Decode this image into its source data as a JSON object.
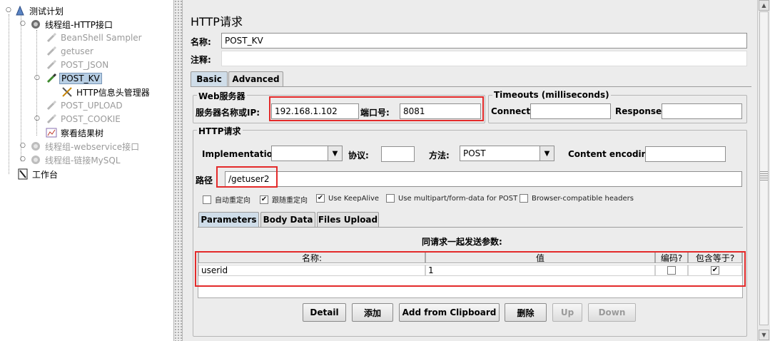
{
  "tree": {
    "items": [
      {
        "label": "测试计划",
        "icon": "test-plan-icon",
        "disabled": false,
        "selected": false
      },
      {
        "label": "线程组-HTTP接口",
        "icon": "gear-icon",
        "disabled": false,
        "selected": false
      },
      {
        "label": "BeanShell Sampler",
        "icon": "pipette-icon",
        "disabled": true,
        "selected": false
      },
      {
        "label": "getuser",
        "icon": "pipette-icon",
        "disabled": true,
        "selected": false
      },
      {
        "label": "POST_JSON",
        "icon": "pipette-icon",
        "disabled": true,
        "selected": false
      },
      {
        "label": "POST_KV",
        "icon": "pipette-icon",
        "disabled": false,
        "selected": true
      },
      {
        "label": "HTTP信息头管理器",
        "icon": "tools-icon",
        "disabled": false,
        "selected": false
      },
      {
        "label": "POST_UPLOAD",
        "icon": "pipette-icon",
        "disabled": true,
        "selected": false
      },
      {
        "label": "POST_COOKIE",
        "icon": "pipette-icon",
        "disabled": true,
        "selected": false
      },
      {
        "label": "察看结果树",
        "icon": "chart-icon",
        "disabled": false,
        "selected": false
      },
      {
        "label": "线程组-webservice接口",
        "icon": "gear-icon",
        "disabled": true,
        "selected": false
      },
      {
        "label": "线程组-链接MySQL",
        "icon": "gear-icon",
        "disabled": true,
        "selected": false
      },
      {
        "label": "工作台",
        "icon": "workbench-icon",
        "disabled": false,
        "selected": false
      }
    ]
  },
  "panel": {
    "title": "HTTP请求",
    "name_label": "名称:",
    "name_value": "POST_KV",
    "comment_label": "注释:",
    "tabs": [
      "Basic",
      "Advanced"
    ],
    "web_server": {
      "title": "Web服务器",
      "server_label": "服务器名称或IP:",
      "server_value": "192.168.1.102",
      "port_label": "端口号:",
      "port_value": "8081"
    },
    "timeouts": {
      "title": "Timeouts (milliseconds)",
      "connect_label": "Connect:",
      "connect_value": "",
      "response_label": "Response:",
      "response_value": ""
    },
    "http_request": {
      "title": "HTTP请求",
      "implementation_label": "Implementation:",
      "implementation_value": "",
      "protocol_label": "协议:",
      "protocol_value": "",
      "method_label": "方法:",
      "method_value": "POST",
      "encoding_label": "Content encoding:",
      "encoding_value": "",
      "path_label": "路径",
      "path_value": "/getuser2"
    },
    "options": [
      {
        "label": "自动重定向",
        "checked": false
      },
      {
        "label": "跟随重定向",
        "checked": true
      },
      {
        "label": "Use KeepAlive",
        "checked": true
      },
      {
        "label": "Use multipart/form-data for POST",
        "checked": false
      },
      {
        "label": "Browser-compatible headers",
        "checked": false
      }
    ],
    "sub_tabs": [
      "Parameters",
      "Body Data",
      "Files Upload"
    ],
    "params": {
      "caption": "同请求一起发送参数:",
      "columns": [
        "名称:",
        "值",
        "编码?",
        "包含等于?"
      ],
      "rows": [
        {
          "name": "userid",
          "value": "1",
          "encode": false,
          "include_equals": true
        }
      ]
    },
    "buttons": [
      {
        "label": "Detail",
        "disabled": false
      },
      {
        "label": "添加",
        "disabled": false
      },
      {
        "label": "Add from Clipboard",
        "disabled": false
      },
      {
        "label": "删除",
        "disabled": false
      },
      {
        "label": "Up",
        "disabled": true
      },
      {
        "label": "Down",
        "disabled": true
      }
    ]
  }
}
